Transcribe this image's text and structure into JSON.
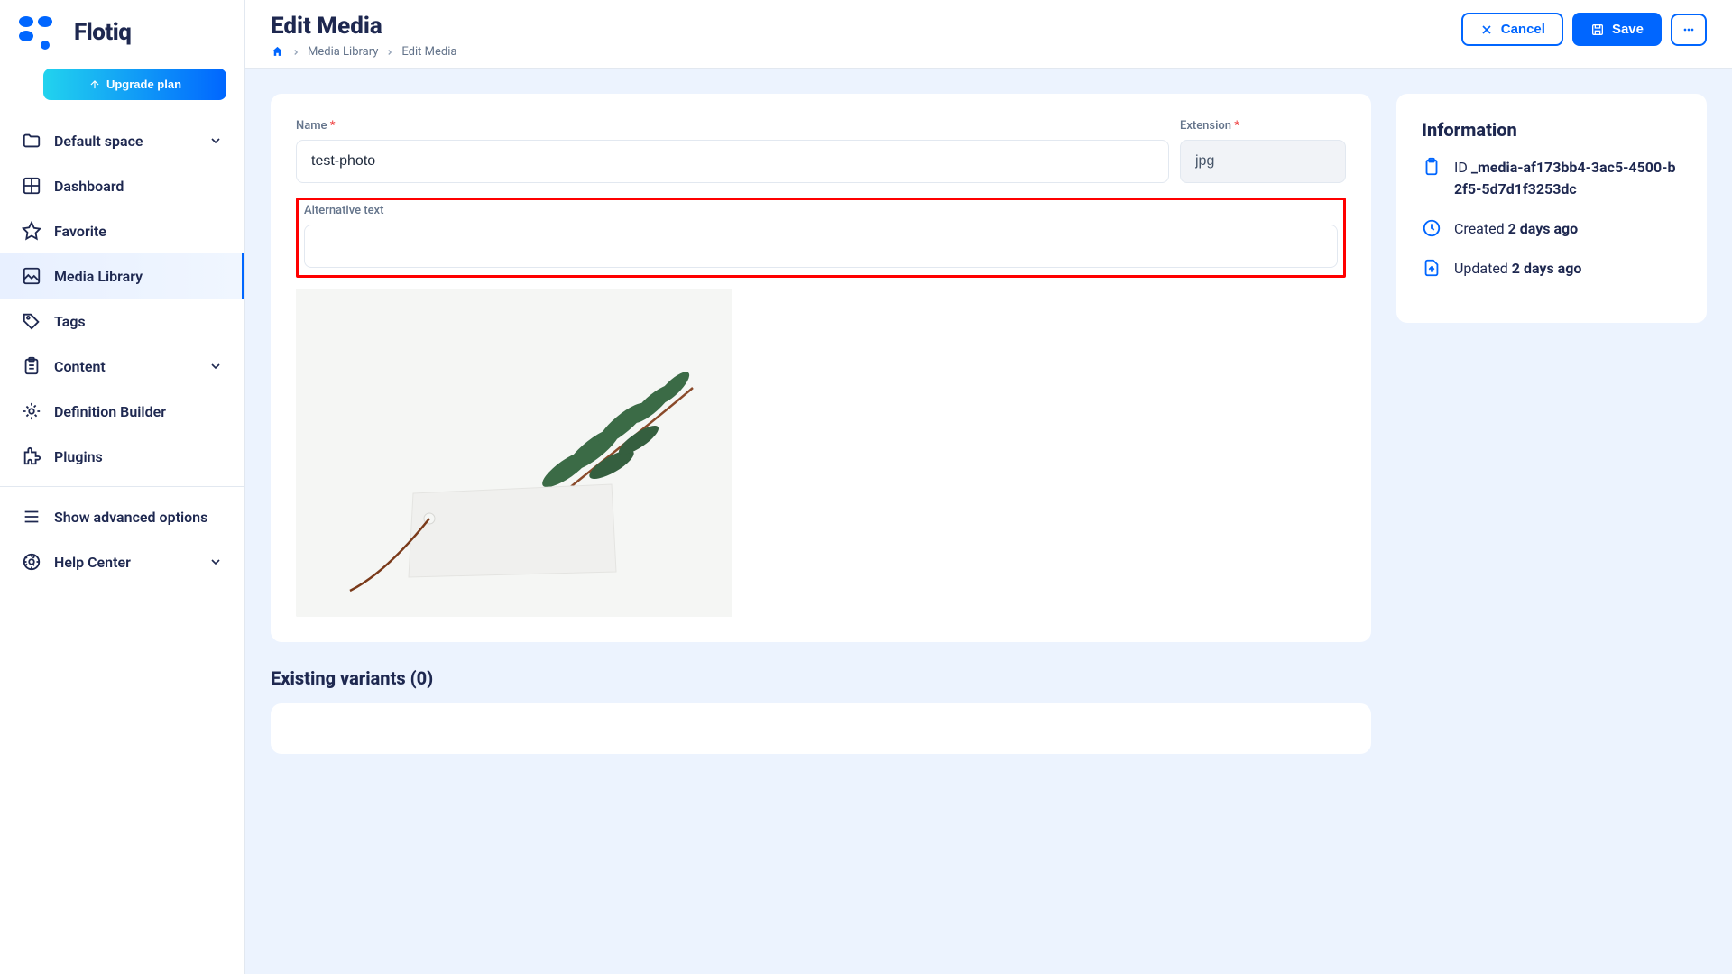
{
  "brand": {
    "name": "Flotiq"
  },
  "sidebar": {
    "upgrade_label": "Upgrade plan",
    "items": [
      {
        "label": "Default space",
        "icon": "folder",
        "expandable": true
      },
      {
        "label": "Dashboard",
        "icon": "dashboard"
      },
      {
        "label": "Favorite",
        "icon": "star"
      },
      {
        "label": "Media Library",
        "icon": "image",
        "active": true
      },
      {
        "label": "Tags",
        "icon": "tag"
      },
      {
        "label": "Content",
        "icon": "clipboard",
        "expandable": true
      },
      {
        "label": "Definition Builder",
        "icon": "gear"
      },
      {
        "label": "Plugins",
        "icon": "puzzle"
      }
    ],
    "advanced_label": "Show advanced options",
    "help_label": "Help Center"
  },
  "header": {
    "title": "Edit Media",
    "breadcrumb": {
      "media_library": "Media Library",
      "current": "Edit Media"
    },
    "actions": {
      "cancel": "Cancel",
      "save": "Save"
    }
  },
  "form": {
    "name_label": "Name",
    "name_value": "test-photo",
    "ext_label": "Extension",
    "ext_value": "jpg",
    "alt_label": "Alternative text",
    "alt_value": ""
  },
  "variants": {
    "heading": "Existing variants (0)"
  },
  "info": {
    "heading": "Information",
    "id_label": "ID",
    "id_value": "_media-af173bb4-3ac5-4500-b2f5-5d7d1f3253dc",
    "created_label": "Created",
    "created_value": "2 days ago",
    "updated_label": "Updated",
    "updated_value": "2 days ago"
  }
}
